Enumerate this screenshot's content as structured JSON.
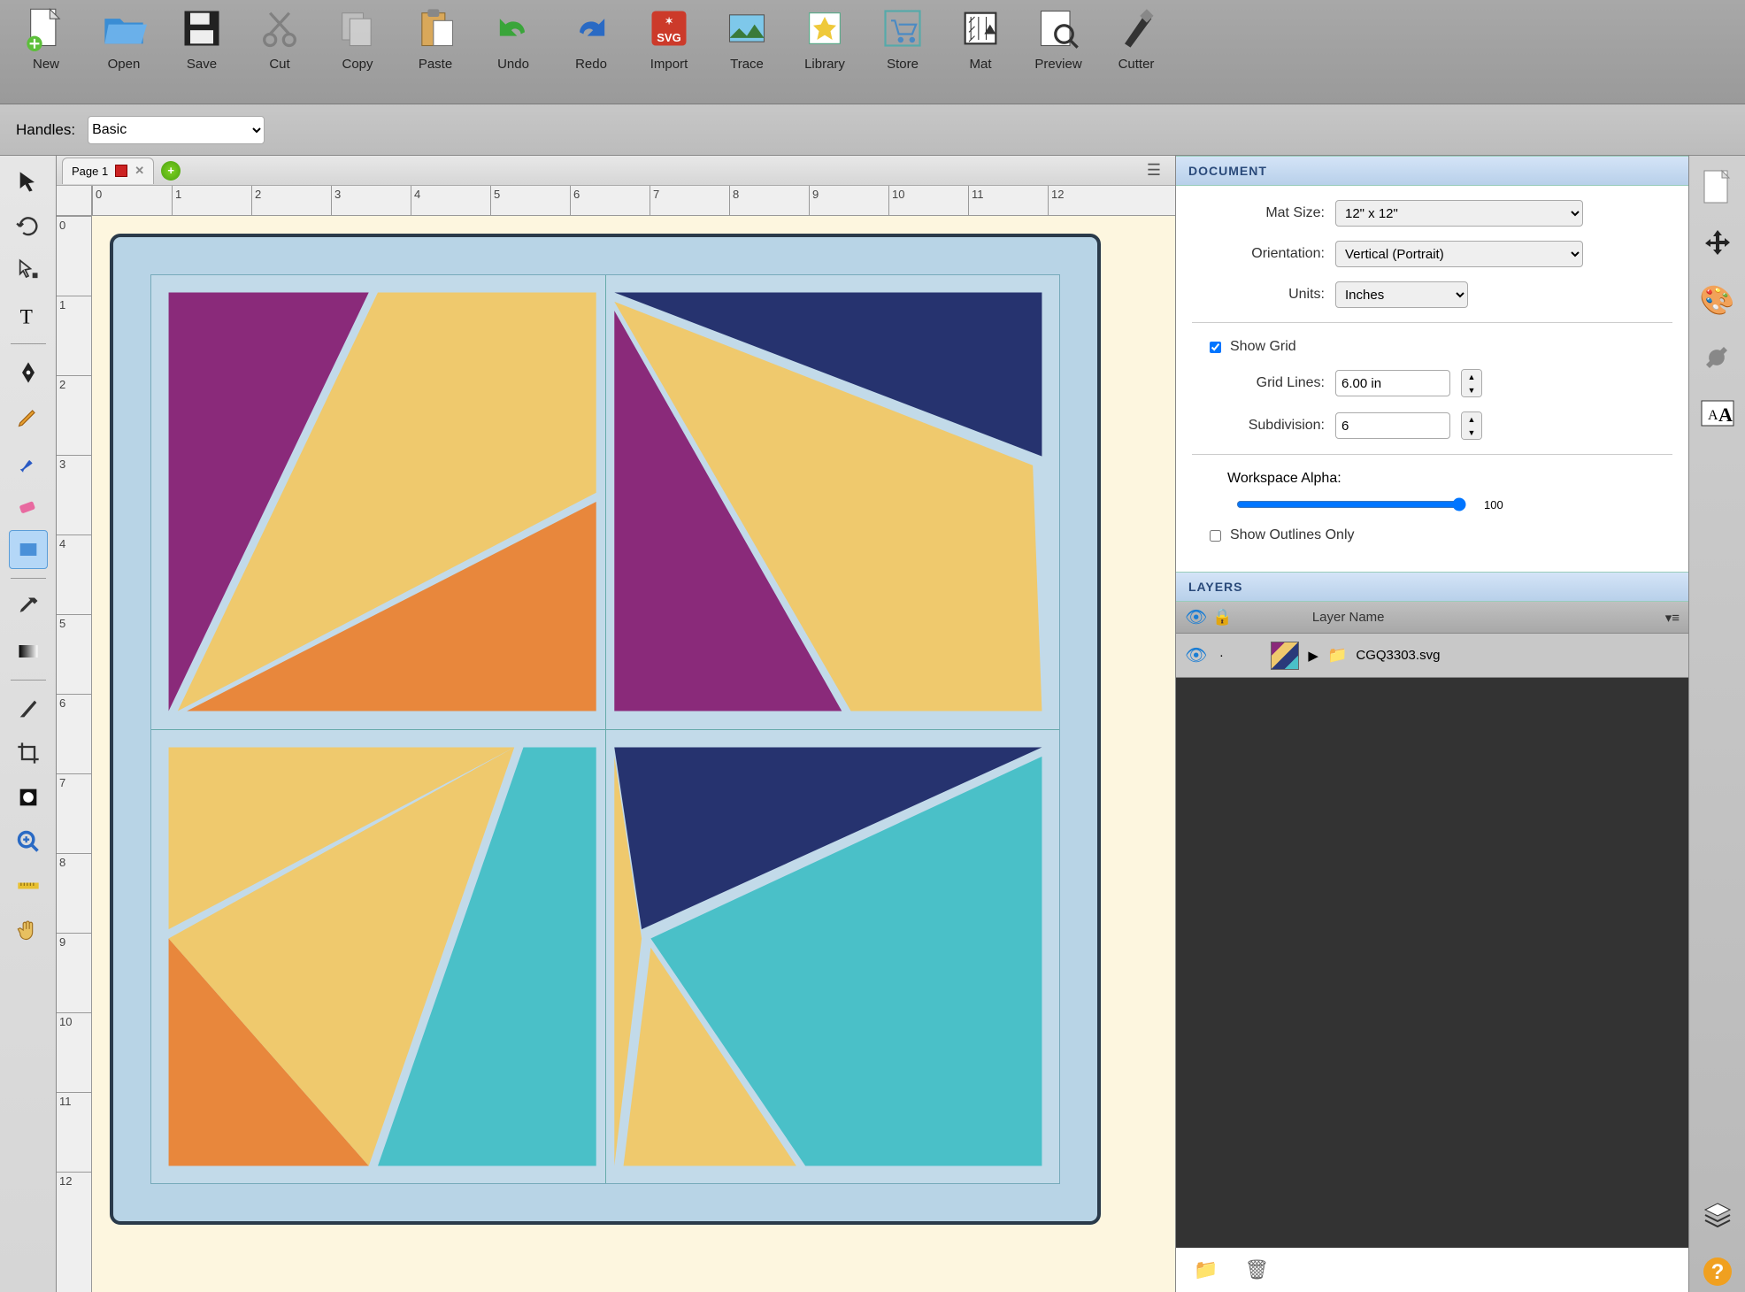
{
  "toolbar": {
    "items": [
      {
        "id": "new",
        "label": "New"
      },
      {
        "id": "open",
        "label": "Open"
      },
      {
        "id": "save",
        "label": "Save"
      },
      {
        "id": "cut",
        "label": "Cut"
      },
      {
        "id": "copy",
        "label": "Copy"
      },
      {
        "id": "paste",
        "label": "Paste"
      },
      {
        "id": "undo",
        "label": "Undo"
      },
      {
        "id": "redo",
        "label": "Redo"
      },
      {
        "id": "import",
        "label": "Import"
      },
      {
        "id": "trace",
        "label": "Trace"
      },
      {
        "id": "library",
        "label": "Library"
      },
      {
        "id": "store",
        "label": "Store"
      },
      {
        "id": "mat",
        "label": "Mat"
      },
      {
        "id": "preview",
        "label": "Preview"
      },
      {
        "id": "cutter",
        "label": "Cutter"
      }
    ]
  },
  "handles": {
    "label": "Handles:",
    "value": "Basic"
  },
  "tabs": {
    "page": "Page 1"
  },
  "ruler": {
    "ticks": [
      "0",
      "1",
      "2",
      "3",
      "4",
      "5",
      "6",
      "7",
      "8",
      "9",
      "10",
      "11",
      "12"
    ]
  },
  "document": {
    "title": "DOCUMENT",
    "mat_size_label": "Mat Size:",
    "mat_size": "12\" x 12\"",
    "orientation_label": "Orientation:",
    "orientation": "Vertical (Portrait)",
    "units_label": "Units:",
    "units": "Inches",
    "show_grid_label": "Show Grid",
    "show_grid": true,
    "grid_lines_label": "Grid Lines:",
    "grid_lines": "6.00 in",
    "subdivision_label": "Subdivision:",
    "subdivision": "6",
    "alpha_label": "Workspace Alpha:",
    "alpha": "100",
    "outlines_label": "Show Outlines Only",
    "outlines": false
  },
  "layers": {
    "title": "LAYERS",
    "col": "Layer Name",
    "items": [
      {
        "name": "CGQ3303.svg"
      }
    ]
  },
  "colors": {
    "purple": "#8a2a7a",
    "yellow": "#efc96d",
    "orange": "#e8873c",
    "navy": "#26336f",
    "teal": "#4ac0c8"
  }
}
